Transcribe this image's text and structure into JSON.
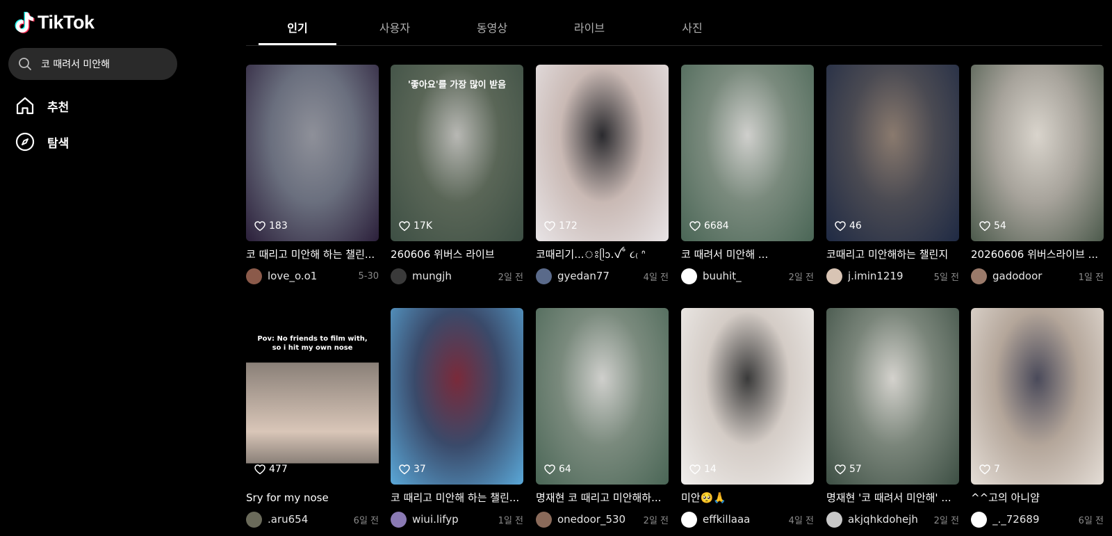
{
  "app": {
    "logo_text": "TikTok"
  },
  "search": {
    "value": "코 때려서 미안해",
    "icon": "search-icon"
  },
  "nav": [
    {
      "label": "추천",
      "icon": "home-icon"
    },
    {
      "label": "탐색",
      "icon": "compass-icon"
    }
  ],
  "tabs": [
    {
      "label": "인기",
      "active": true
    },
    {
      "label": "사용자"
    },
    {
      "label": "동영상"
    },
    {
      "label": "라이브"
    },
    {
      "label": "사진"
    }
  ],
  "videos": [
    {
      "likes": "183",
      "caption": "코 때리고 미안해 하는 챌린...",
      "user": "love_o.o1",
      "date": "5-30",
      "avatar_color": "#8b5a4a",
      "thumb": [
        "#2b1f3a",
        "#6a6f7e",
        "#8e9099"
      ]
    },
    {
      "likes": "17K",
      "caption": "260606 위버스 라이브",
      "user": "mungjh",
      "date": "2일 전",
      "avatar_color": "#3a3a3a",
      "thumb": [
        "#3d4f44",
        "#5a6657",
        "#b8b8b4"
      ],
      "overlay": "'좋아요'를 가장 많이 받음"
    },
    {
      "likes": "172",
      "caption": "코때리기...ঃᥫᩣ.ꪜ˚ ૮₍ ᐢ",
      "user": "gyedan77",
      "date": "4일 전",
      "avatar_color": "#5a6a8a",
      "thumb": [
        "#e8e4e6",
        "#c9b9b4",
        "#2a2a2e"
      ]
    },
    {
      "likes": "6684",
      "caption": "코 때려서 미안해 ...",
      "user": "buuhit_",
      "date": "2일 전",
      "avatar_color": "#ffffff",
      "thumb": [
        "#4a6656",
        "#7a8a7d",
        "#cfcfcc"
      ]
    },
    {
      "likes": "46",
      "caption": "코때리고 미안해하는 챌린지",
      "user": "j.imin1219",
      "date": "5일 전",
      "avatar_color": "#d8c4b4",
      "thumb": [
        "#1f2a44",
        "#4a4a52",
        "#8a7a6e"
      ]
    },
    {
      "likes": "54",
      "caption": "20260606 위버스라이브 ...",
      "user": "gadodoor",
      "date": "1일 전",
      "avatar_color": "#9a7a6a",
      "thumb": [
        "#4c5a4c",
        "#a7a39b",
        "#d9d4cc"
      ]
    },
    {
      "likes": "477",
      "caption": "Sry for my nose",
      "user": ".aru654",
      "date": "6일 전",
      "avatar_color": "#6a6a5a",
      "thumb": [
        "#000000",
        "#8a8078",
        "#d9c6b8"
      ],
      "overlay": "Pov: No friends to film with,\nso i hit my own nose"
    },
    {
      "likes": "37",
      "caption": "코 때리고 미안해 하는 챌린...",
      "user": "wiui.lifyp",
      "date": "1일 전",
      "avatar_color": "#8a7ab4",
      "thumb": [
        "#5aa8d8",
        "#3a4a6a",
        "#7a2a3a"
      ]
    },
    {
      "likes": "64",
      "caption": "명재현 코 때리고 미안해하...",
      "user": "onedoor_530",
      "date": "2일 전",
      "avatar_color": "#8a6a5a",
      "thumb": [
        "#4a6656",
        "#7a8a7d",
        "#cfcfcc"
      ]
    },
    {
      "likes": "14",
      "caption": "미안🥺🙏",
      "user": "effkillaaa",
      "date": "4일 전",
      "avatar_color": "#ffffff",
      "thumb": [
        "#f0eeec",
        "#d4ccc6",
        "#3a3a3a"
      ]
    },
    {
      "likes": "57",
      "caption": "명재현 '코 때려서 미안해' ...",
      "user": "akjqhkdohejh",
      "date": "2일 전",
      "avatar_color": "#c8c8c8",
      "thumb": [
        "#3d4f44",
        "#7a857a",
        "#d4d2cd"
      ]
    },
    {
      "likes": "7",
      "caption": "^^고의 아니얌",
      "user": "_._72689",
      "date": "6일 전",
      "avatar_color": "#ffffff",
      "thumb": [
        "#e4ddd6",
        "#b4a69a",
        "#4a4a5a"
      ]
    }
  ]
}
